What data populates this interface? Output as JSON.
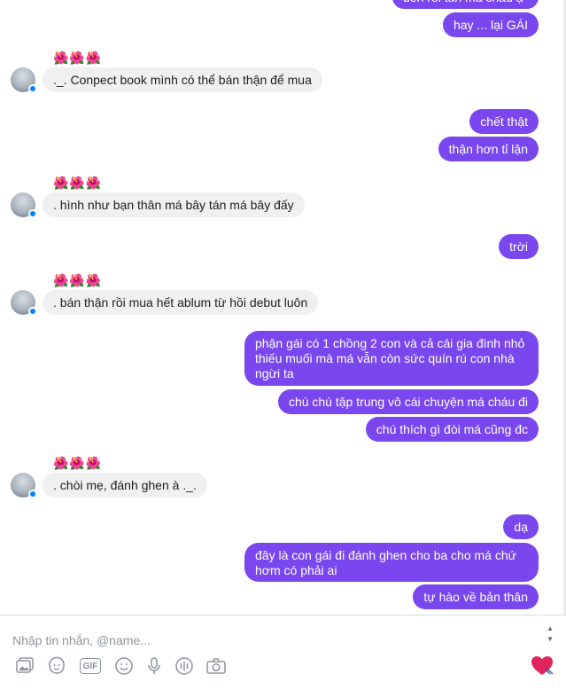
{
  "messages": {
    "m0": "đến rồi tấn má cháu ạ",
    "m1": "hay ... lại GÁI",
    "m2": "._. Conpect book mình có thể bán thận để mua",
    "m3": "chết thật",
    "m4": "thận hơn tỉ lận",
    "m5": ". hình như bạn thân má bây tán má bây đấy",
    "m6": "trời",
    "m7": ". bán thận rồi mua hết ablum từ hồi debut luôn",
    "m8": "phận gái có 1 chồng 2 con và cả cái gia đình nhỏ thiếu muối mà má vẫn còn sức quín rú con nhà ngừi ta",
    "m9": "chú chú tập trung vô cái chuyện má cháu đi",
    "m10": "chú thích gì đòi má cũng đc",
    "m11": ". chòi mẹ, đánh ghen à ._.",
    "m12": "dạ",
    "m13": "đây là con gái đi đánh ghen cho ba cho má chứ hơm có phải ai",
    "m14": "tự hào về bản thân"
  },
  "reactions": {
    "hibiscus": "🌺🌺🌺"
  },
  "composer": {
    "placeholder": "Nhập tin nhắn, @name...",
    "tools": [
      "image-icon",
      "sticker-icon",
      "gif-icon",
      "emoji-icon",
      "microphone-icon",
      "audio-clip-icon",
      "camera-icon"
    ],
    "gif_label": "GIF",
    "send_icon": "heart-icon"
  },
  "colors": {
    "outgoing": "#7a47ee",
    "incoming": "#f1f0f0",
    "accent": "#0084ff"
  }
}
